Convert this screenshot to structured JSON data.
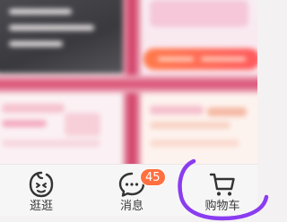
{
  "tab_bar": {
    "tabs": [
      {
        "key": "guangguang",
        "label": "逛逛",
        "icon": "guangguang-face-icon",
        "active": false
      },
      {
        "key": "messages",
        "label": "消息",
        "icon": "chat-bubble-icon",
        "badge": "45",
        "active": false
      },
      {
        "key": "cart",
        "label": "购物车",
        "icon": "shopping-cart-icon",
        "active": false
      }
    ]
  },
  "colors": {
    "badge": "#ff6f3f",
    "highlight_ring": "#8a3cf0",
    "label_text": "#3a3a3a",
    "accent_red": "#d0335e"
  }
}
